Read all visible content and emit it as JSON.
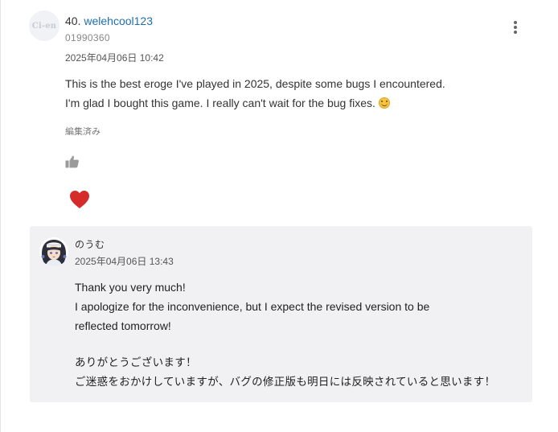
{
  "comment": {
    "rank": "40.",
    "username": "welehcool123",
    "user_id": "01990360",
    "timestamp": "2025年04月06日 10:42",
    "avatar_text": "Ci-en",
    "lines": [
      "This is the best eroge I've played in 2025, despite some bugs I encountered.",
      "I'm glad I bought this game. I really can't wait for the bug fixes."
    ],
    "edited_label": "編集済み",
    "icons": {
      "menu": "more-vertical-icon",
      "like": "thumbs-up-icon",
      "reaction": "heart-icon",
      "emoji": "smiling-face-icon"
    }
  },
  "reply": {
    "author": "のうむ",
    "timestamp": "2025年04月06日 13:43",
    "lines_en": [
      "Thank you very much!",
      "I apologize for the inconvenience, but I expect the revised version to be",
      "reflected tomorrow!"
    ],
    "lines_ja": [
      "ありがとうございます！",
      "ご迷惑をおかけしていますが、バグの修正版も明日には反映されていると思います！"
    ]
  },
  "colors": {
    "username_link": "#1e6fae",
    "heart": "#d62b2b",
    "reply_background": "#f1f1f3",
    "thumb_icon": "#9a9a9a"
  }
}
